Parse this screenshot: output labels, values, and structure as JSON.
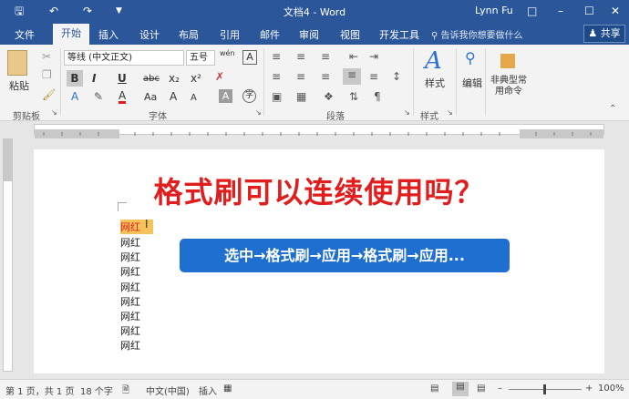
{
  "titlebar": {
    "doc_title": "文档4 - Word",
    "user": "Lynn Fu",
    "save_icon": "save-icon",
    "undo_icon": "undo-icon",
    "redo_icon": "redo-icon",
    "customize_icon": "customize-icon"
  },
  "tabs": [
    "文件",
    "开始",
    "插入",
    "设计",
    "布局",
    "引用",
    "邮件",
    "审阅",
    "视图",
    "开发工具"
  ],
  "tell_me": "告诉我你想要做什么",
  "share": "共享",
  "ribbon": {
    "paste_label": "粘贴",
    "font_name": "等线 (中文正文)",
    "font_size": "五号",
    "wen": "wén",
    "bold": "B",
    "italic": "I",
    "underline": "U",
    "strike": "abc",
    "subscript": "x₂",
    "superscript": "x²",
    "font_color": "A",
    "case": "Aa",
    "grow": "A",
    "shrink": "A",
    "styles_label": "样式",
    "edit_label": "编辑",
    "typical_cmd_label": "非典型常用命令",
    "group_clipboard": "剪贴板",
    "group_font": "字体",
    "group_paragraph": "段落",
    "group_styles": "样式"
  },
  "document": {
    "heading": "格式刷可以连续使用吗？",
    "lines": [
      "网红",
      "网红",
      "网红",
      "网红",
      "网红",
      "网红",
      "网红",
      "网红",
      "网红"
    ],
    "callout": "选中→格式刷→应用→格式刷→应用..."
  },
  "status": {
    "page": "第 1 页，共 1 页",
    "words": "18 个字",
    "language": "中文(中国)",
    "mode": "插入",
    "zoom": "100%"
  },
  "colors": {
    "brand": "#2b579a",
    "heading": "#e11d1d",
    "callout": "#1f6fd1"
  }
}
